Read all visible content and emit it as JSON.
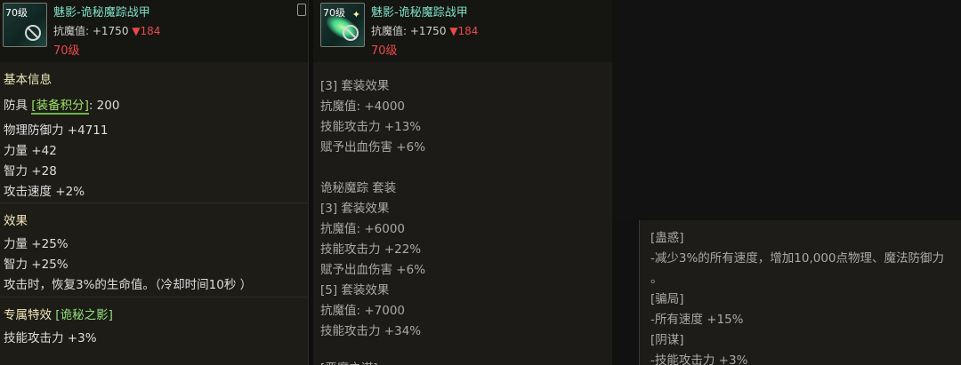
{
  "item": {
    "level_badge": "70级",
    "name": "魅影-诡秘魔踪战甲",
    "magic_resist_label": "抗魔值: +1750",
    "magic_resist_delta": "▼184",
    "required_level": "70级"
  },
  "panel1": {
    "basic_info_heading": "基本信息",
    "armor_label": "防具",
    "score_tag": "[装备积分]",
    "score_value": ": 200",
    "stats": [
      "物理防御力 +4711",
      "力量 +42",
      "智力 +28",
      "攻击速度 +2%"
    ],
    "effect_heading": "效果",
    "effects": [
      "力量 +25%",
      "智力 +25%",
      "攻击时，恢复3%的生命值。（冷却时间10秒 ）"
    ],
    "special_heading": "专属特效",
    "special_tag": "[诡秘之影]",
    "special_stats": [
      "技能攻击力 +3%"
    ]
  },
  "panel2": {
    "lines": [
      "[3] 套装效果",
      "抗魔值: +4000",
      "技能攻击力 +13%",
      "赋予出血伤害 +6%",
      "",
      "诡秘魔踪  套装",
      "[3] 套装效果",
      "抗魔值: +6000",
      "技能攻击力 +22%",
      "赋予出血伤害 +6%",
      "[5] 套装效果",
      "抗魔值: +7000",
      "技能攻击力 +34%",
      "",
      "[恶魔之谋]"
    ]
  },
  "panel3": {
    "lines": [
      "[蛊惑]",
      "-减少3%的所有速度，增加10,000点物理、魔法防御力",
      "。",
      "[骗局]",
      "-所有速度 +15%",
      "[阴谋]",
      "-技能攻击力 +3%"
    ]
  },
  "colors": {
    "title": "#7fe0c8",
    "decrease": "#e84a4a",
    "heading": "#f0e6b8",
    "highlight": "#9be36b"
  }
}
